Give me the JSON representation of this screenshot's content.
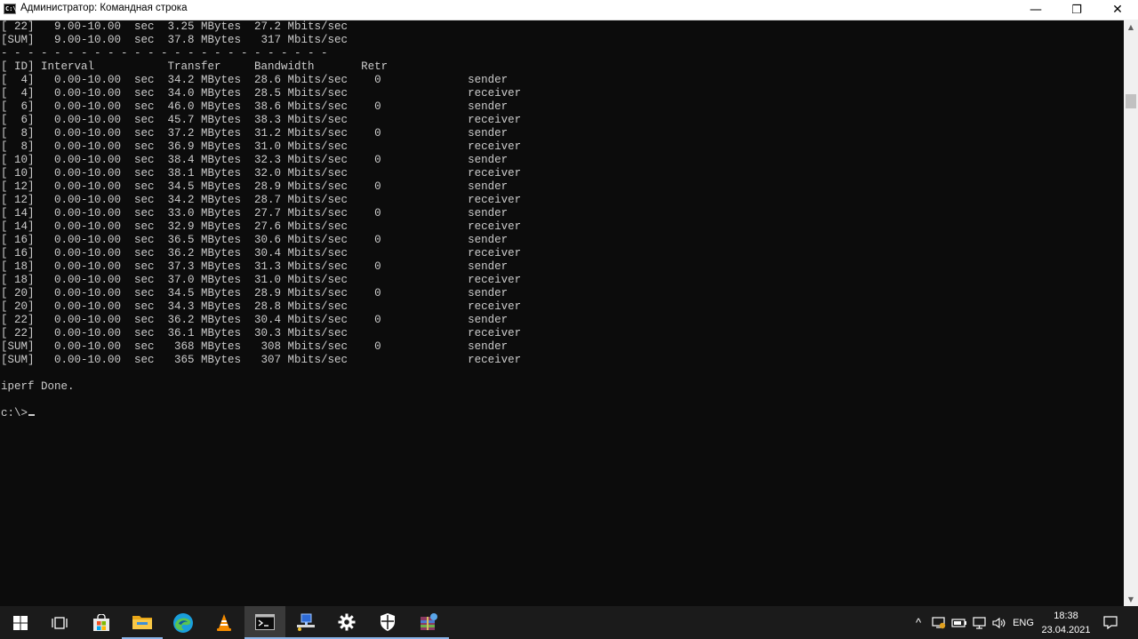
{
  "window": {
    "title": "Администратор: Командная строка",
    "icon_label": "C:\\",
    "minimize_glyph": "—",
    "maximize_glyph": "❐",
    "close_glyph": "✕"
  },
  "console": {
    "lines": [
      "[ 22]   9.00-10.00  sec  3.25 MBytes  27.2 Mbits/sec",
      "[SUM]   9.00-10.00  sec  37.8 MBytes   317 Mbits/sec",
      "- - - - - - - - - - - - - - - - - - - - - - - - -",
      "[ ID] Interval           Transfer     Bandwidth       Retr",
      "[  4]   0.00-10.00  sec  34.2 MBytes  28.6 Mbits/sec    0             sender",
      "[  4]   0.00-10.00  sec  34.0 MBytes  28.5 Mbits/sec                  receiver",
      "[  6]   0.00-10.00  sec  46.0 MBytes  38.6 Mbits/sec    0             sender",
      "[  6]   0.00-10.00  sec  45.7 MBytes  38.3 Mbits/sec                  receiver",
      "[  8]   0.00-10.00  sec  37.2 MBytes  31.2 Mbits/sec    0             sender",
      "[  8]   0.00-10.00  sec  36.9 MBytes  31.0 Mbits/sec                  receiver",
      "[ 10]   0.00-10.00  sec  38.4 MBytes  32.3 Mbits/sec    0             sender",
      "[ 10]   0.00-10.00  sec  38.1 MBytes  32.0 Mbits/sec                  receiver",
      "[ 12]   0.00-10.00  sec  34.5 MBytes  28.9 Mbits/sec    0             sender",
      "[ 12]   0.00-10.00  sec  34.2 MBytes  28.7 Mbits/sec                  receiver",
      "[ 14]   0.00-10.00  sec  33.0 MBytes  27.7 Mbits/sec    0             sender",
      "[ 14]   0.00-10.00  sec  32.9 MBytes  27.6 Mbits/sec                  receiver",
      "[ 16]   0.00-10.00  sec  36.5 MBytes  30.6 Mbits/sec    0             sender",
      "[ 16]   0.00-10.00  sec  36.2 MBytes  30.4 Mbits/sec                  receiver",
      "[ 18]   0.00-10.00  sec  37.3 MBytes  31.3 Mbits/sec    0             sender",
      "[ 18]   0.00-10.00  sec  37.0 MBytes  31.0 Mbits/sec                  receiver",
      "[ 20]   0.00-10.00  sec  34.5 MBytes  28.9 Mbits/sec    0             sender",
      "[ 20]   0.00-10.00  sec  34.3 MBytes  28.8 Mbits/sec                  receiver",
      "[ 22]   0.00-10.00  sec  36.2 MBytes  30.4 Mbits/sec    0             sender",
      "[ 22]   0.00-10.00  sec  36.1 MBytes  30.3 Mbits/sec                  receiver",
      "[SUM]   0.00-10.00  sec   368 MBytes   308 Mbits/sec    0             sender",
      "[SUM]   0.00-10.00  sec   365 MBytes   307 Mbits/sec                  receiver",
      "",
      "iperf Done.",
      "",
      "c:\\>"
    ]
  },
  "scrollbar": {
    "up_glyph": "▲",
    "down_glyph": "▼"
  },
  "taskbar": {
    "icons": [
      "windows-start-icon",
      "task-view-icon",
      "microsoft-store-icon",
      "file-explorer-icon",
      "edge-browser-icon",
      "vlc-icon",
      "command-prompt-icon",
      "network-computer-icon",
      "settings-gear-icon",
      "security-shield-icon",
      "winrar-icon"
    ],
    "accent_color": "#8ab4e8",
    "tray": {
      "chevron_glyph": "^",
      "language": "ENG",
      "time": "18:38",
      "date": "23.04.2021"
    }
  }
}
